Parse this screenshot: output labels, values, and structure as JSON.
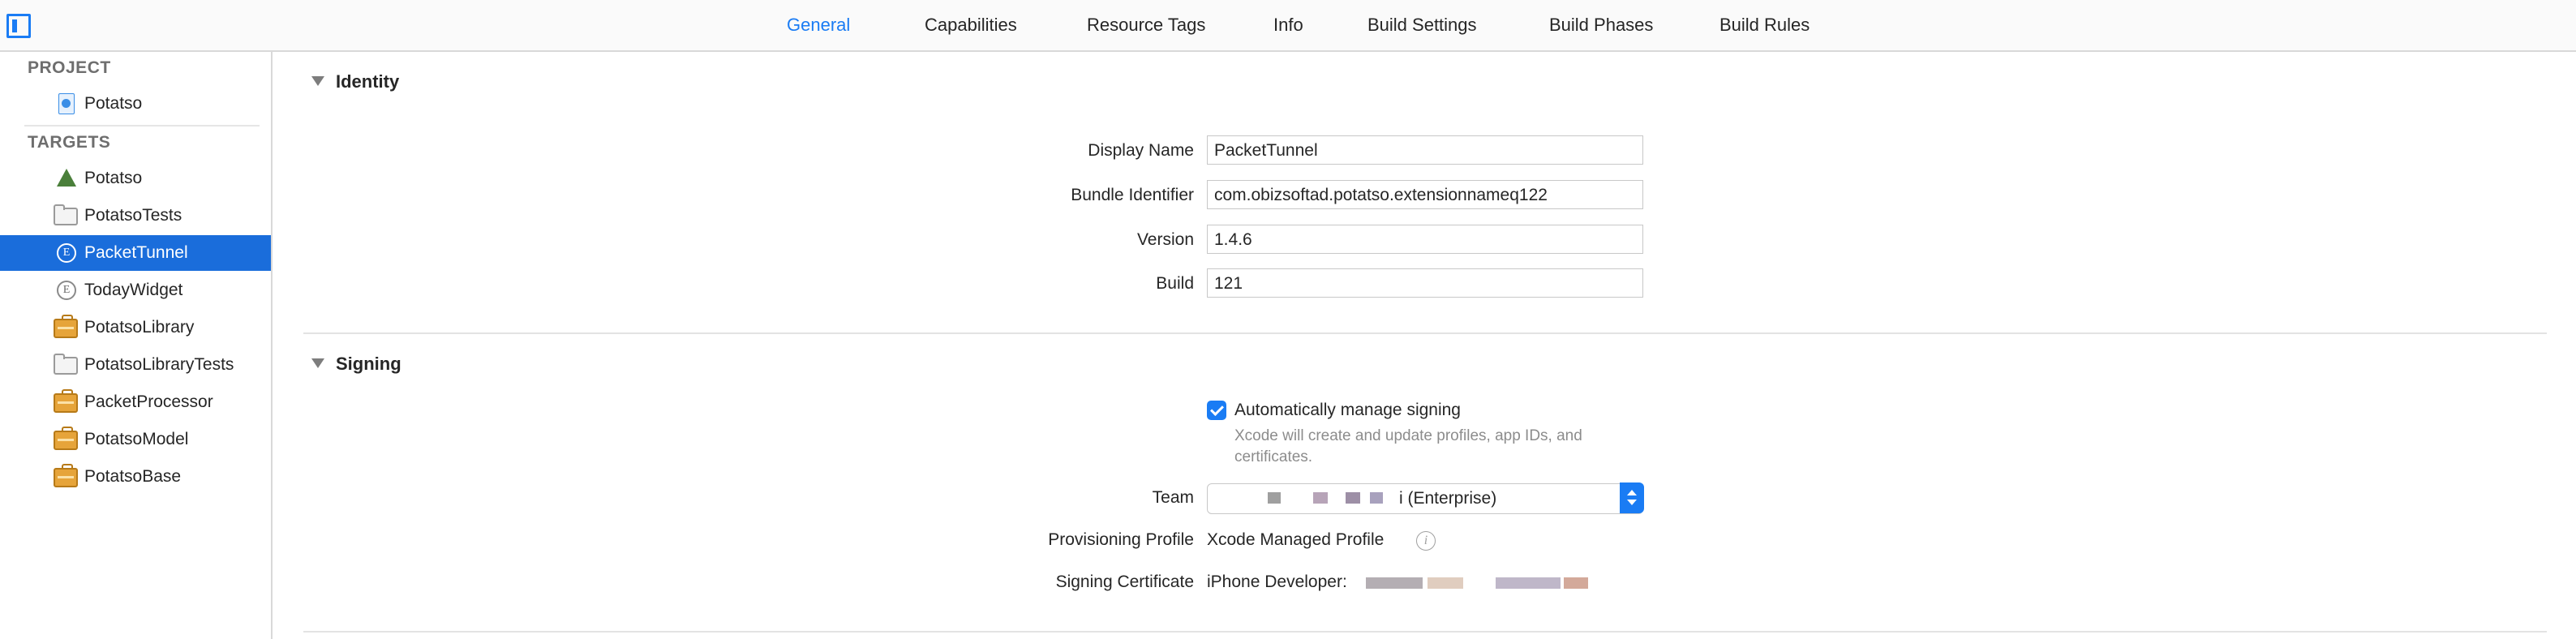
{
  "tabs": [
    "General",
    "Capabilities",
    "Resource Tags",
    "Info",
    "Build Settings",
    "Build Phases",
    "Build Rules"
  ],
  "active_tab": "General",
  "accent_color": "#1a7cf4",
  "sidebar": {
    "project_header": "PROJECT",
    "project_item": {
      "label": "Potatso",
      "icon": "project-document-icon"
    },
    "targets_header": "TARGETS",
    "targets": [
      {
        "label": "Potatso",
        "icon": "app-target-icon",
        "selected": false
      },
      {
        "label": "PotatsoTests",
        "icon": "folder-icon",
        "selected": false
      },
      {
        "label": "PacketTunnel",
        "icon": "extension-icon",
        "selected": true
      },
      {
        "label": "TodayWidget",
        "icon": "extension-icon",
        "selected": false
      },
      {
        "label": "PotatsoLibrary",
        "icon": "library-icon",
        "selected": false
      },
      {
        "label": "PotatsoLibraryTests",
        "icon": "folder-icon",
        "selected": false
      },
      {
        "label": "PacketProcessor",
        "icon": "library-icon",
        "selected": false
      },
      {
        "label": "PotatsoModel",
        "icon": "library-icon",
        "selected": false
      },
      {
        "label": "PotatsoBase",
        "icon": "library-icon",
        "selected": false
      }
    ]
  },
  "identity": {
    "title": "Identity",
    "display_name_label": "Display Name",
    "display_name_value": "PacketTunnel",
    "bundle_id_label": "Bundle Identifier",
    "bundle_id_value": "com.obizsoftad.potatso.extensionnameq122",
    "version_label": "Version",
    "version_value": "1.4.6",
    "build_label": "Build",
    "build_value": "121"
  },
  "signing": {
    "title": "Signing",
    "auto_manage_label": "Automatically manage signing",
    "auto_manage_checked": true,
    "auto_manage_hint_line1": "Xcode will create and update profiles, app IDs, and",
    "auto_manage_hint_line2": "certificates.",
    "team_label": "Team",
    "team_value_suffix": "i (Enterprise)",
    "provisioning_label": "Provisioning Profile",
    "provisioning_value": "Xcode Managed Profile",
    "certificate_label": "Signing Certificate",
    "certificate_value": "iPhone Developer:"
  }
}
